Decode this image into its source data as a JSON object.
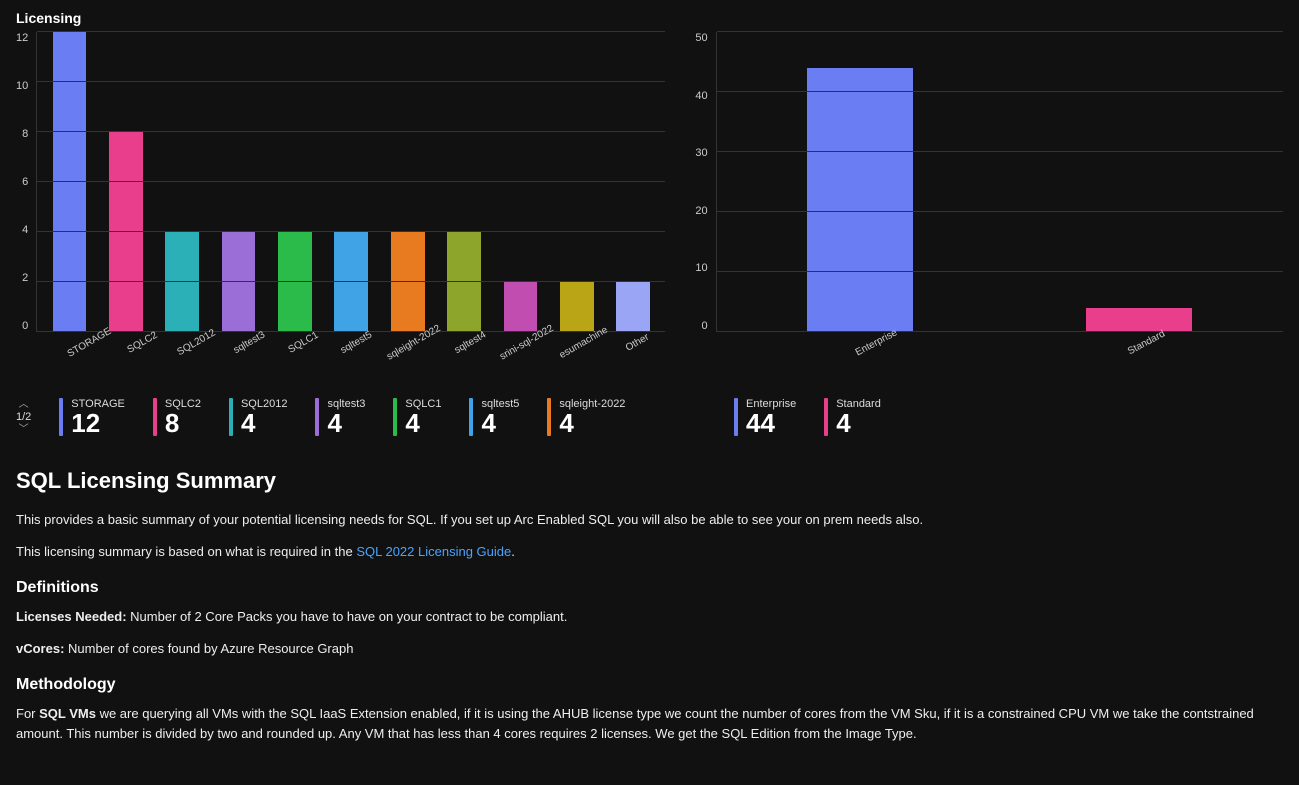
{
  "heading": "Licensing",
  "pager": {
    "page": "1/2"
  },
  "chart_data": [
    {
      "id": "by-machine",
      "type": "bar",
      "categories": [
        "STORAGE",
        "SQLC2",
        "SQL2012",
        "sqltest3",
        "SQLC1",
        "sqltest5",
        "sqleight-2022",
        "sqltest4",
        "srini-sql-2022",
        "esumachine",
        "Other"
      ],
      "values": [
        12,
        8,
        4,
        4,
        4,
        4,
        4,
        4,
        2,
        2,
        2
      ],
      "colors": [
        "#6b7df2",
        "#e83e8c",
        "#2bb0b7",
        "#9b6dd7",
        "#2bbb4a",
        "#3fa3e6",
        "#e87b1f",
        "#8ea52b",
        "#c24db0",
        "#b9a516",
        "#9aa6f5"
      ],
      "ylim": [
        0,
        12
      ],
      "yticks": [
        0,
        2,
        4,
        6,
        8,
        10,
        12
      ]
    },
    {
      "id": "by-edition",
      "type": "bar",
      "categories": [
        "Enterprise",
        "Standard"
      ],
      "values": [
        44,
        4
      ],
      "colors": [
        "#6b7df2",
        "#e83e8c"
      ],
      "ylim": [
        0,
        50
      ],
      "yticks": [
        0,
        10,
        20,
        30,
        40,
        50
      ]
    }
  ],
  "kpis_left": [
    {
      "label": "STORAGE",
      "value": "12",
      "color": "#6b7df2"
    },
    {
      "label": "SQLC2",
      "value": "8",
      "color": "#e83e8c"
    },
    {
      "label": "SQL2012",
      "value": "4",
      "color": "#2bb0b7"
    },
    {
      "label": "sqltest3",
      "value": "4",
      "color": "#9b6dd7"
    },
    {
      "label": "SQLC1",
      "value": "4",
      "color": "#2bbb4a"
    },
    {
      "label": "sqltest5",
      "value": "4",
      "color": "#3fa3e6"
    },
    {
      "label": "sqleight-2022",
      "value": "4",
      "color": "#e87b1f"
    }
  ],
  "kpis_right": [
    {
      "label": "Enterprise",
      "value": "44",
      "color": "#6b7df2"
    },
    {
      "label": "Standard",
      "value": "4",
      "color": "#e83e8c"
    }
  ],
  "summary": {
    "title": "SQL Licensing Summary",
    "intro1": "This provides a basic summary of your potential licensing needs for SQL. If you set up Arc Enabled SQL you will also be able to see your on prem needs also.",
    "intro2_prefix": "This licensing summary is based on what is required in the ",
    "intro2_link": "SQL 2022 Licensing Guide",
    "intro2_suffix": ".",
    "definitions_title": "Definitions",
    "def1_label": "Licenses Needed:",
    "def1_text": " Number of 2 Core Packs you have to have on your contract to be compliant.",
    "def2_label": "vCores:",
    "def2_text": " Number of cores found by Azure Resource Graph",
    "methodology_title": "Methodology",
    "method_prefix": "For ",
    "method_bold": "SQL VMs",
    "method_text": " we are querying all VMs with the SQL IaaS Extension enabled, if it is using the AHUB license type we count the number of cores from the VM Sku, if it is a constrained CPU VM we take the contstrained amount. This number is divided by two and rounded up. Any VM that has less than 4 cores requires 2 licenses. We get the SQL Edition from the Image Type."
  }
}
